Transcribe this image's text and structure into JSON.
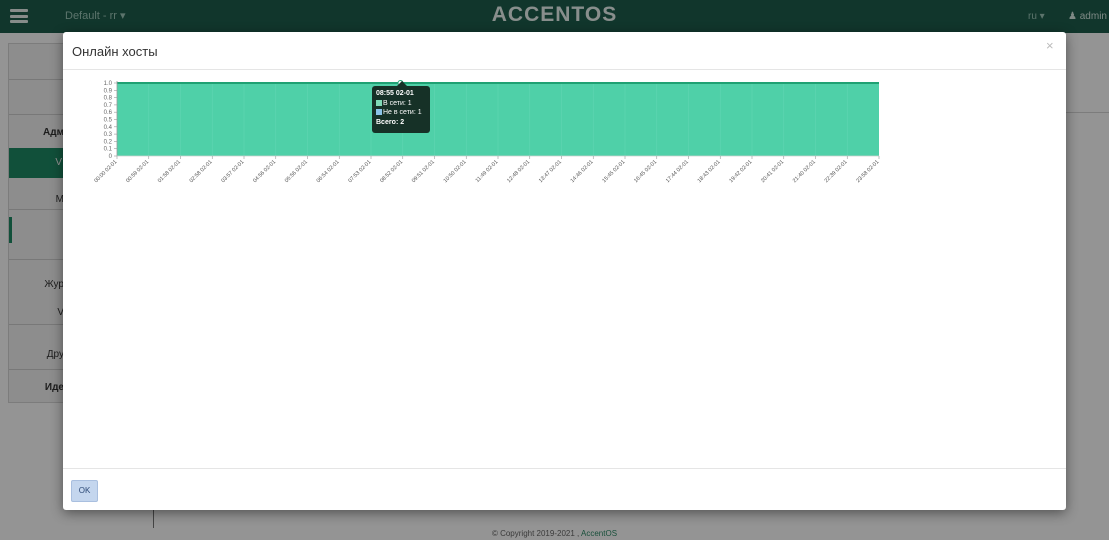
{
  "app": {
    "project_selector": "Default - rr ▾",
    "brand": "ACCENTOS",
    "language": "ru ▾",
    "user_menu": "admin ▾"
  },
  "sidebar": {
    "items": [
      "Адм",
      "V",
      "M",
      "Жур",
      "V",
      "Дру",
      "Иде"
    ]
  },
  "footer": {
    "text": "© Copyright 2019-2021 ,",
    "link": "AccentOS"
  },
  "modal": {
    "title": "Онлайн хосты",
    "close_symbol": "×",
    "ok_label": "OK"
  },
  "colors": {
    "topbar": "#1e5e4c",
    "area_fill": "#4fd0a8",
    "area_line": "#1fa173",
    "series_online": "#7fd9b6",
    "series_offline": "#8cc3e8"
  },
  "tooltip": {
    "title": "08:55 02-01",
    "rows": [
      {
        "label": "В сети: 1",
        "color": "#7fd9b6"
      },
      {
        "label": "Не в сети: 1",
        "color": "#8cc3e8"
      }
    ],
    "total": "Всего: 2"
  },
  "chart_data": {
    "type": "area",
    "y_ticks": [
      "0",
      "0.1",
      "0.2",
      "0.3",
      "0.4",
      "0.5",
      "0.6",
      "0.7",
      "0.8",
      "0.9",
      "1.0"
    ],
    "ylim": [
      0,
      1
    ],
    "x_ticks": [
      "00:00 02-01",
      "00:59 02-01",
      "01:58 02-01",
      "02:58 02-01",
      "03:57 02-01",
      "04:56 02-01",
      "05:56 02-01",
      "06:54 02-01",
      "07:53 02-01",
      "08:52 02-01",
      "09:51 02-01",
      "10:50 02-01",
      "11:49 02-01",
      "12:48 02-01",
      "13:47 02-01",
      "14:46 02-01",
      "15:45 02-01",
      "16:45 02-01",
      "17:44 02-01",
      "18:43 02-01",
      "19:42 02-01",
      "20:41 02-01",
      "21:40 02-01",
      "22:39 02-01",
      "23:58 02-01"
    ],
    "values": [
      1,
      1,
      1,
      1,
      1,
      1,
      1,
      1,
      1,
      1,
      1,
      1,
      1,
      1,
      1,
      1,
      1,
      1,
      1,
      1,
      1,
      1,
      1,
      1,
      1
    ],
    "grid": true
  }
}
